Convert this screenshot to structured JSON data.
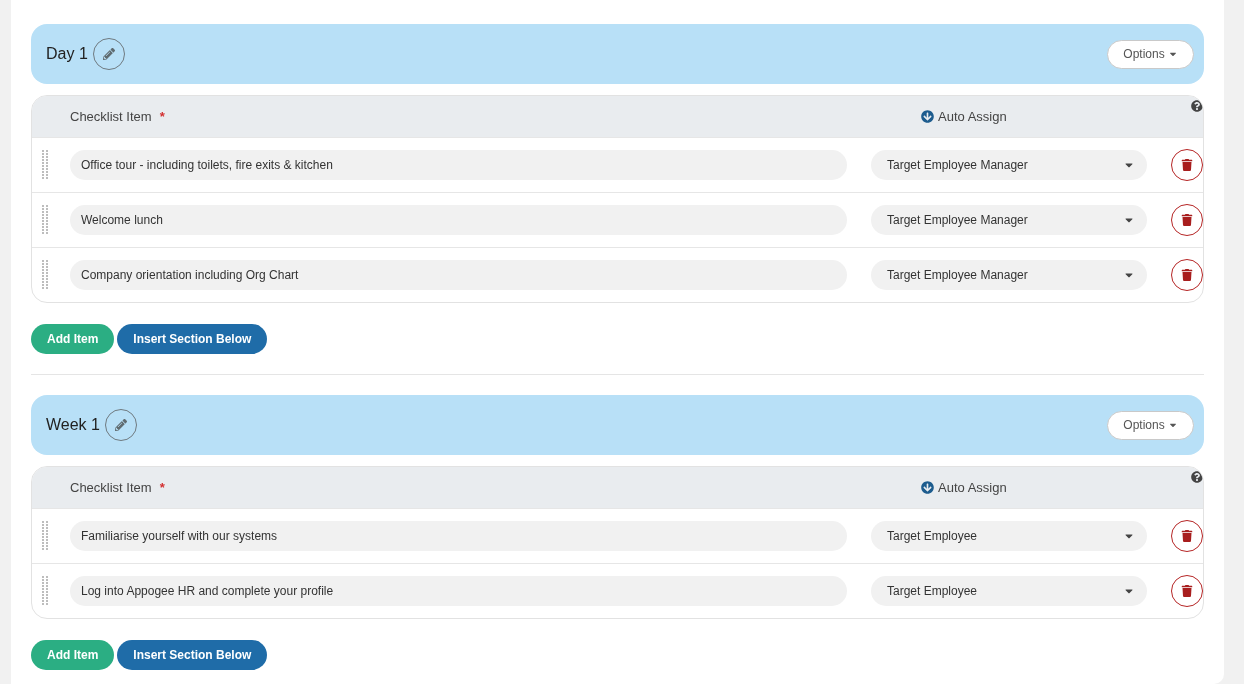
{
  "sections": [
    {
      "title": "Day 1",
      "options": "Options",
      "columns": {
        "item": "Checklist Item",
        "required_mark": "*",
        "assign": "Auto Assign"
      },
      "rows": [
        {
          "item": "Office tour - including toilets, fire exits & kitchen",
          "assignee": "Target Employee Manager"
        },
        {
          "item": "Welcome lunch",
          "assignee": "Target Employee Manager"
        },
        {
          "item": "Company orientation including Org Chart",
          "assignee": "Target Employee Manager"
        }
      ],
      "buttons": [
        {
          "kind": "add",
          "label": "Add Item"
        },
        {
          "kind": "insert",
          "label": "Insert Section Below"
        }
      ]
    },
    {
      "title": "Week 1",
      "options": "Options",
      "columns": {
        "item": "Checklist Item",
        "required_mark": "*",
        "assign": "Auto Assign"
      },
      "rows": [
        {
          "item": "Familiarise yourself with our systems",
          "assignee": "Target Employee"
        },
        {
          "item": "Log into Appogee HR and complete your profile",
          "assignee": "Target Employee"
        }
      ],
      "buttons": [
        {
          "kind": "add",
          "label": "Add Item"
        },
        {
          "kind": "insert",
          "label": "Insert Section Below"
        }
      ]
    }
  ]
}
